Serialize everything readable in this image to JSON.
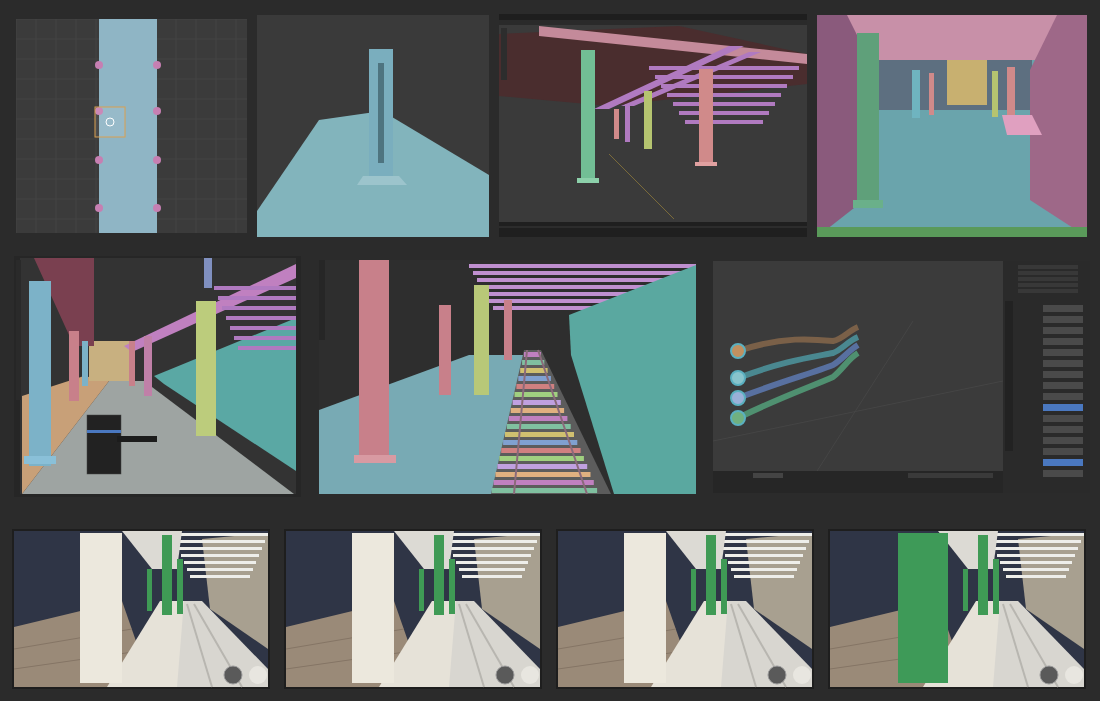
{
  "gallery": {
    "rows": [
      {
        "panels": [
          {
            "kind": "closeup"
          },
          {
            "kind": "perspective"
          },
          {
            "kind": "viewport"
          },
          {
            "kind": "platform"
          }
        ]
      },
      {
        "panels": [
          {
            "kind": "menu"
          },
          {
            "kind": "tracks"
          },
          {
            "kind": "curves"
          }
        ]
      },
      {
        "panels": [
          {
            "kind": "render"
          },
          {
            "kind": "render"
          },
          {
            "kind": "render"
          },
          {
            "kind": "greenrender"
          }
        ]
      }
    ]
  }
}
